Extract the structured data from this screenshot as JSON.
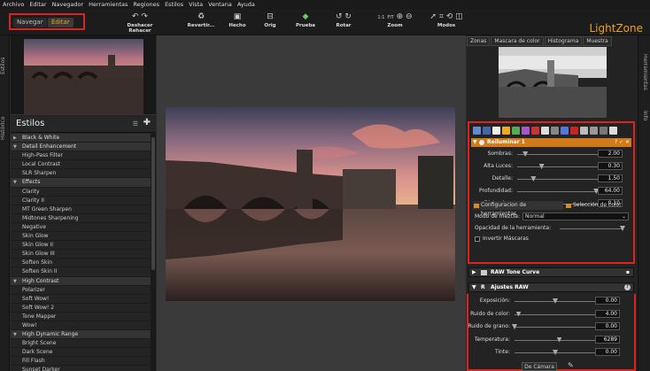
{
  "menu": [
    "Archivo",
    "Editar",
    "Navegador",
    "Herramientas",
    "Regiones",
    "Estilos",
    "Vista",
    "Ventana",
    "Ayuda"
  ],
  "modes": {
    "browse": "Navegar",
    "edit": "Editar"
  },
  "toolbar": {
    "undo_redo": "Deshacer Rehacer",
    "revert": "Revertir...",
    "done": "Hecho",
    "orig": "Orig",
    "proof": "Prueba",
    "rotate": "Rotar",
    "zoom_one": "1:1",
    "zoom_fit": "FIT",
    "zoom": "Zoom",
    "modes": "Modos"
  },
  "brand": "LightZone",
  "left_tabs": {
    "styles": "Estilos",
    "history": "Histórico"
  },
  "styles_title": "Estilos",
  "styles": [
    {
      "label": "Black & White",
      "kind": "catc"
    },
    {
      "label": "Detail Enhancement",
      "kind": "cat"
    },
    {
      "label": "High-Pass Filter",
      "kind": "item"
    },
    {
      "label": "Local Contrast",
      "kind": "item"
    },
    {
      "label": "SLR Sharpen",
      "kind": "item"
    },
    {
      "label": "Effects",
      "kind": "cat"
    },
    {
      "label": "Clarity",
      "kind": "item"
    },
    {
      "label": "Clarity II",
      "kind": "item"
    },
    {
      "label": "MT Green Sharpen",
      "kind": "item"
    },
    {
      "label": "Midtones Sharpening",
      "kind": "item"
    },
    {
      "label": "Negative",
      "kind": "item"
    },
    {
      "label": "Skin Glow",
      "kind": "item"
    },
    {
      "label": "Skin Glow II",
      "kind": "item"
    },
    {
      "label": "Skin Glow III",
      "kind": "item"
    },
    {
      "label": "Soften Skin",
      "kind": "item"
    },
    {
      "label": "Soften Skin II",
      "kind": "item"
    },
    {
      "label": "High Contrast",
      "kind": "cat"
    },
    {
      "label": "Polarizer",
      "kind": "item"
    },
    {
      "label": "Soft Wow!",
      "kind": "item"
    },
    {
      "label": "Soft Wow! 2",
      "kind": "item"
    },
    {
      "label": "Tone Mapper",
      "kind": "item"
    },
    {
      "label": "Wow!",
      "kind": "item"
    },
    {
      "label": "High Dynamic Range",
      "kind": "cat"
    },
    {
      "label": "Bright Scene",
      "kind": "item"
    },
    {
      "label": "Dark Scene",
      "kind": "item"
    },
    {
      "label": "Fill Flash",
      "kind": "item"
    },
    {
      "label": "Sunset Darker",
      "kind": "item"
    }
  ],
  "zone_tabs": [
    "Zonas",
    "Mascara de color",
    "Histograma",
    "Muestra"
  ],
  "right_tabs": {
    "tools": "Herramientas",
    "info": "Info"
  },
  "relight": {
    "title": "Reiluminar 1",
    "sliders": [
      {
        "label": "Sombras:",
        "value": "2.00",
        "pos": 0.1
      },
      {
        "label": "Alta Luces:",
        "value": "0.30",
        "pos": 0.3
      },
      {
        "label": "Detalle:",
        "value": "1.50",
        "pos": 0.2
      },
      {
        "label": "Profundidad:",
        "value": "64.00",
        "pos": 0.97
      },
      {
        "label": "Distorsion:",
        "value": "0.10",
        "pos": 0.08
      }
    ],
    "tab_config": "Configuracion de herramientas",
    "tab_color": "Selección de color",
    "blend_label": "Modo de mezcla:",
    "blend_value": "Normal",
    "opacity_label": "Opacidad de la herramienta:",
    "invert_label": "Invertir Máscaras"
  },
  "tone_curve": "RAW Tone Curve",
  "raw": {
    "title": "Ajustes RAW",
    "sliders": [
      {
        "label": "Exposición:",
        "value": "0.00",
        "pos": 0.5
      },
      {
        "label": "Ruido de color:",
        "value": "4.00",
        "pos": 0.05
      },
      {
        "label": "Ruido de grano:",
        "value": "0.00",
        "pos": 0.0
      },
      {
        "label": "Temperatura:",
        "value": "6289",
        "pos": 0.55
      },
      {
        "label": "Tinte:",
        "value": "0.00",
        "pos": 0.5
      }
    ],
    "camera_button": "De Cámara"
  }
}
